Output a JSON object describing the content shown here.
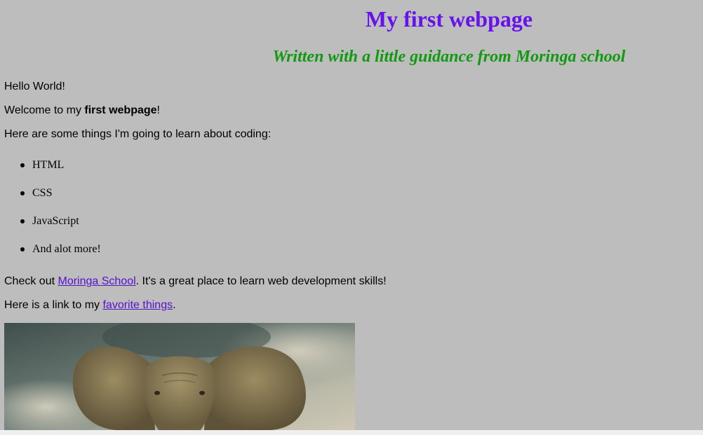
{
  "header": {
    "title": "My first webpage",
    "subtitle": "Written with a little guidance from Moringa school"
  },
  "content": {
    "hello": "Hello World!",
    "welcome_prefix": "Welcome to my ",
    "welcome_bold": "first webpage",
    "welcome_suffix": "!",
    "intro": "Here are some things I'm going to learn about coding:",
    "learn_items": [
      "HTML",
      "CSS",
      "JavaScript",
      "And alot more!"
    ],
    "checkout_prefix": "Check out ",
    "moringa_link": "Moringa School",
    "checkout_suffix": ". It's a great place to learn web development skills!",
    "favorites_prefix": "Here is a link to my ",
    "favorites_link": "favorite things",
    "favorites_suffix": "."
  },
  "image": {
    "subject": "elephant-photo",
    "sky_color": "#4a5a55",
    "elephant_color": "#8a7a52"
  },
  "colors": {
    "page_background": "#bdbdbd",
    "title": "#6611ee",
    "subtitle": "#119911",
    "link": "#5511cc"
  }
}
